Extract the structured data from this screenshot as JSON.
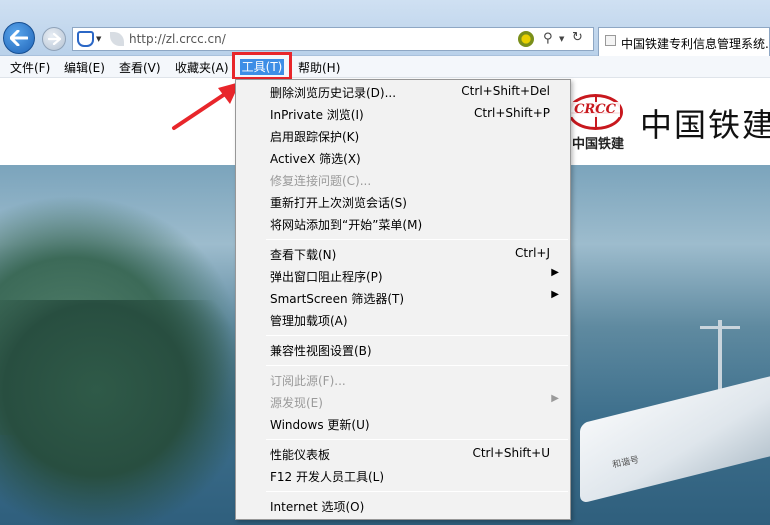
{
  "browser": {
    "url": "http://zl.crcc.cn/",
    "tab_title": "中国铁建专利信息管理系统..."
  },
  "menubar": {
    "file": "文件(F)",
    "edit": "编辑(E)",
    "view": "查看(V)",
    "favorites": "收藏夹(A)",
    "tools": "工具(T)",
    "help": "帮助(H)"
  },
  "page": {
    "logo_text": "CRCC",
    "logo_subtitle": "中国铁建",
    "site_title": "中国铁建",
    "train_label": "和谐号"
  },
  "tools_menu": {
    "items": [
      {
        "label": "删除浏览历史记录(D)...",
        "shortcut": "Ctrl+Shift+Del"
      },
      {
        "label": "InPrivate 浏览(I)",
        "shortcut": "Ctrl+Shift+P"
      },
      {
        "label": "启用跟踪保护(K)"
      },
      {
        "label": "ActiveX 筛选(X)"
      },
      {
        "label": "修复连接问题(C)..."
      },
      {
        "label": "重新打开上次浏览会话(S)"
      },
      {
        "label": "将网站添加到“开始”菜单(M)"
      },
      {
        "label": "查看下载(N)",
        "shortcut": "Ctrl+J"
      },
      {
        "label": "弹出窗口阻止程序(P)"
      },
      {
        "label": "SmartScreen 筛选器(T)"
      },
      {
        "label": "管理加载项(A)"
      },
      {
        "label": "兼容性视图设置(B)"
      },
      {
        "label": "订阅此源(F)..."
      },
      {
        "label": "源发现(E)"
      },
      {
        "label": "Windows 更新(U)"
      },
      {
        "label": "性能仪表板",
        "shortcut": "Ctrl+Shift+U"
      },
      {
        "label": "F12 开发人员工具(L)"
      },
      {
        "label": "Internet 选项(O)"
      }
    ]
  },
  "colors": {
    "highlight_box": "#e8262b",
    "menu_selected": "#3d8ee6",
    "disabled_text": "#9a9a9a"
  }
}
